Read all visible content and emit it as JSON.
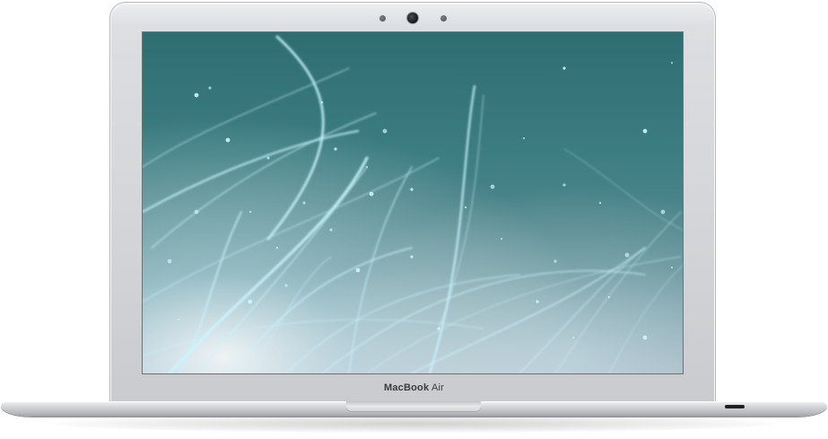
{
  "device": {
    "brand_bold": "MacBook",
    "brand_regular": " Air"
  },
  "screen": {
    "wallpaper": "teal-light-streaks",
    "colors": {
      "top": "#2e6e72",
      "middle": "#3c7d82",
      "bottom": "#9bb1bd",
      "streak": "#c9f4ff"
    }
  },
  "icons": {
    "camera": "camera-icon",
    "port": "port-icon"
  }
}
